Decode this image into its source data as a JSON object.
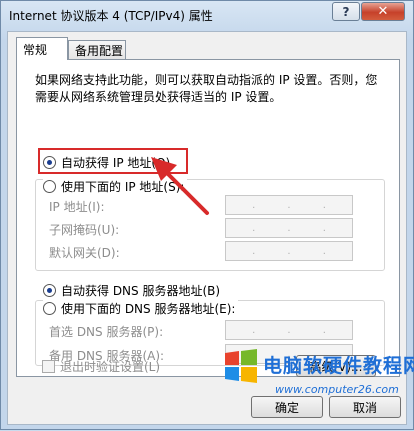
{
  "window": {
    "title": "Internet 协议版本 4 (TCP/IPv4) 属性",
    "help_label": "?",
    "close_label": "✕"
  },
  "tabs": [
    {
      "label": "常规",
      "selected": true
    },
    {
      "label": "备用配置",
      "selected": false
    }
  ],
  "description": "如果网络支持此功能，则可以获取自动指派的 IP 设置。否则，您需要从网络系统管理员处获得适当的 IP 设置。",
  "ip_section": {
    "auto_label": "自动获得 IP 地址(O)",
    "manual_label": "使用下面的 IP 地址(S):",
    "fields": [
      {
        "label": "IP 地址(I):",
        "value": ""
      },
      {
        "label": "子网掩码(U):",
        "value": ""
      },
      {
        "label": "默认网关(D):",
        "value": ""
      }
    ]
  },
  "dns_section": {
    "auto_label": "自动获得 DNS 服务器地址(B)",
    "manual_label": "使用下面的 DNS 服务器地址(E):",
    "fields": [
      {
        "label": "首选 DNS 服务器(P):",
        "value": ""
      },
      {
        "label": "备用 DNS 服务器(A):",
        "value": ""
      }
    ]
  },
  "validate_on_exit_label": "退出时验证设置(L)",
  "buttons": {
    "advanced": "高级(V)...",
    "ok": "确定",
    "cancel": "取消"
  },
  "watermark": {
    "title": "电脑软硬件教程网",
    "url": "www.computer26.com"
  },
  "colors": {
    "highlight": "#d82a2a",
    "watermark_blue": "#1f6fd6"
  }
}
